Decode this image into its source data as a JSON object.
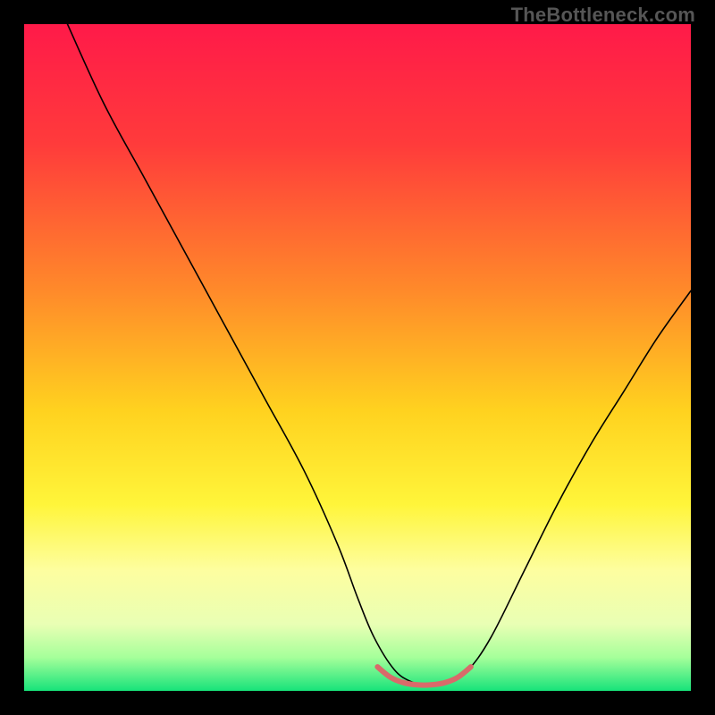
{
  "watermark": "TheBottleneck.com",
  "chart_data": {
    "type": "line",
    "title": "",
    "xlabel": "",
    "ylabel": "",
    "xlim": [
      0,
      100
    ],
    "ylim": [
      0,
      100
    ],
    "grid": false,
    "background_gradient": {
      "stops": [
        {
          "offset": 0,
          "color": "#ff1a49"
        },
        {
          "offset": 18,
          "color": "#ff3b3b"
        },
        {
          "offset": 40,
          "color": "#ff8a2a"
        },
        {
          "offset": 58,
          "color": "#ffd21f"
        },
        {
          "offset": 72,
          "color": "#fff53a"
        },
        {
          "offset": 82,
          "color": "#fdfea0"
        },
        {
          "offset": 90,
          "color": "#e9ffb4"
        },
        {
          "offset": 95,
          "color": "#a5ff9a"
        },
        {
          "offset": 100,
          "color": "#17e37a"
        }
      ]
    },
    "series": [
      {
        "name": "bottleneck-curve",
        "stroke": "#000000",
        "stroke_width": 1.6,
        "x": [
          6.5,
          12,
          18,
          24,
          30,
          36,
          42,
          47,
          50,
          52.5,
          55.5,
          58,
          60,
          62,
          64,
          66.5,
          70,
          75,
          80,
          85,
          90,
          95,
          100
        ],
        "values": [
          100,
          88,
          77,
          66,
          55,
          44,
          33,
          22,
          14,
          8,
          3.2,
          1.4,
          1.0,
          1.0,
          1.4,
          3.0,
          8,
          18,
          28,
          37,
          45,
          53,
          60
        ]
      },
      {
        "name": "optimal-band",
        "stroke": "#d96a6a",
        "stroke_width": 6,
        "x": [
          53,
          55,
          57,
          59,
          61,
          63,
          65,
          67
        ],
        "values": [
          3.6,
          2.0,
          1.2,
          0.9,
          0.9,
          1.2,
          2.0,
          3.6
        ]
      }
    ]
  }
}
